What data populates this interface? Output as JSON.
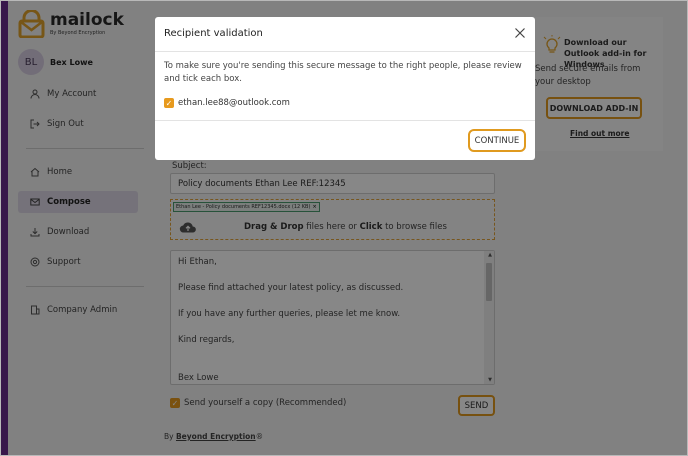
{
  "app": {
    "brand": "mailock",
    "brand_sub": "By Beyond Encryption"
  },
  "user": {
    "initials": "BL",
    "name": "Bex Lowe"
  },
  "sidebar": {
    "account": [
      {
        "label": "My Account",
        "icon": "user-icon"
      },
      {
        "label": "Sign Out",
        "icon": "sign-out-icon"
      }
    ],
    "main": [
      {
        "label": "Home",
        "icon": "home-icon"
      },
      {
        "label": "Compose",
        "icon": "envelope-icon",
        "active": true
      },
      {
        "label": "Download",
        "icon": "download-icon"
      },
      {
        "label": "Support",
        "icon": "support-icon"
      }
    ],
    "admin": [
      {
        "label": "Company Admin",
        "icon": "building-icon"
      }
    ]
  },
  "compose": {
    "subject_label": "Subject:",
    "subject_value": "Policy documents Ethan Lee REF:12345",
    "attachment": "Ethan Lee - Policy documents REF12345.docx (12 KB)",
    "attachment_remove": "×",
    "drop_bold1": "Drag & Drop",
    "drop_mid": " files here or ",
    "drop_bold2": "Click",
    "drop_end": " to browse files",
    "body_lines": [
      "Hi Ethan,",
      "Please find attached your latest policy, as discussed.",
      "If you have any further queries, please let me know.",
      "Kind regards,",
      "Bex Lowe"
    ],
    "copy_label": "Send yourself a copy (Recommended)",
    "copy_checked": true,
    "send_label": "SEND"
  },
  "footer": {
    "prefix": "By ",
    "brand": "Beyond Encryption",
    "mark": "®"
  },
  "addin": {
    "title": "Download our Outlook add-in for Windows",
    "text": "Send secure emails from your desktop",
    "button": "DOWNLOAD ADD-IN",
    "link": "Find out more"
  },
  "modal": {
    "title": "Recipient validation",
    "description": "To make sure you're sending this secure message to the right people, please review and tick each box.",
    "recipient": "ethan.lee88@outlook.com",
    "recipient_checked": true,
    "continue": "CONTINUE"
  },
  "colors": {
    "accent": "#e09a1f",
    "brand_purple": "#6b2c8f"
  }
}
